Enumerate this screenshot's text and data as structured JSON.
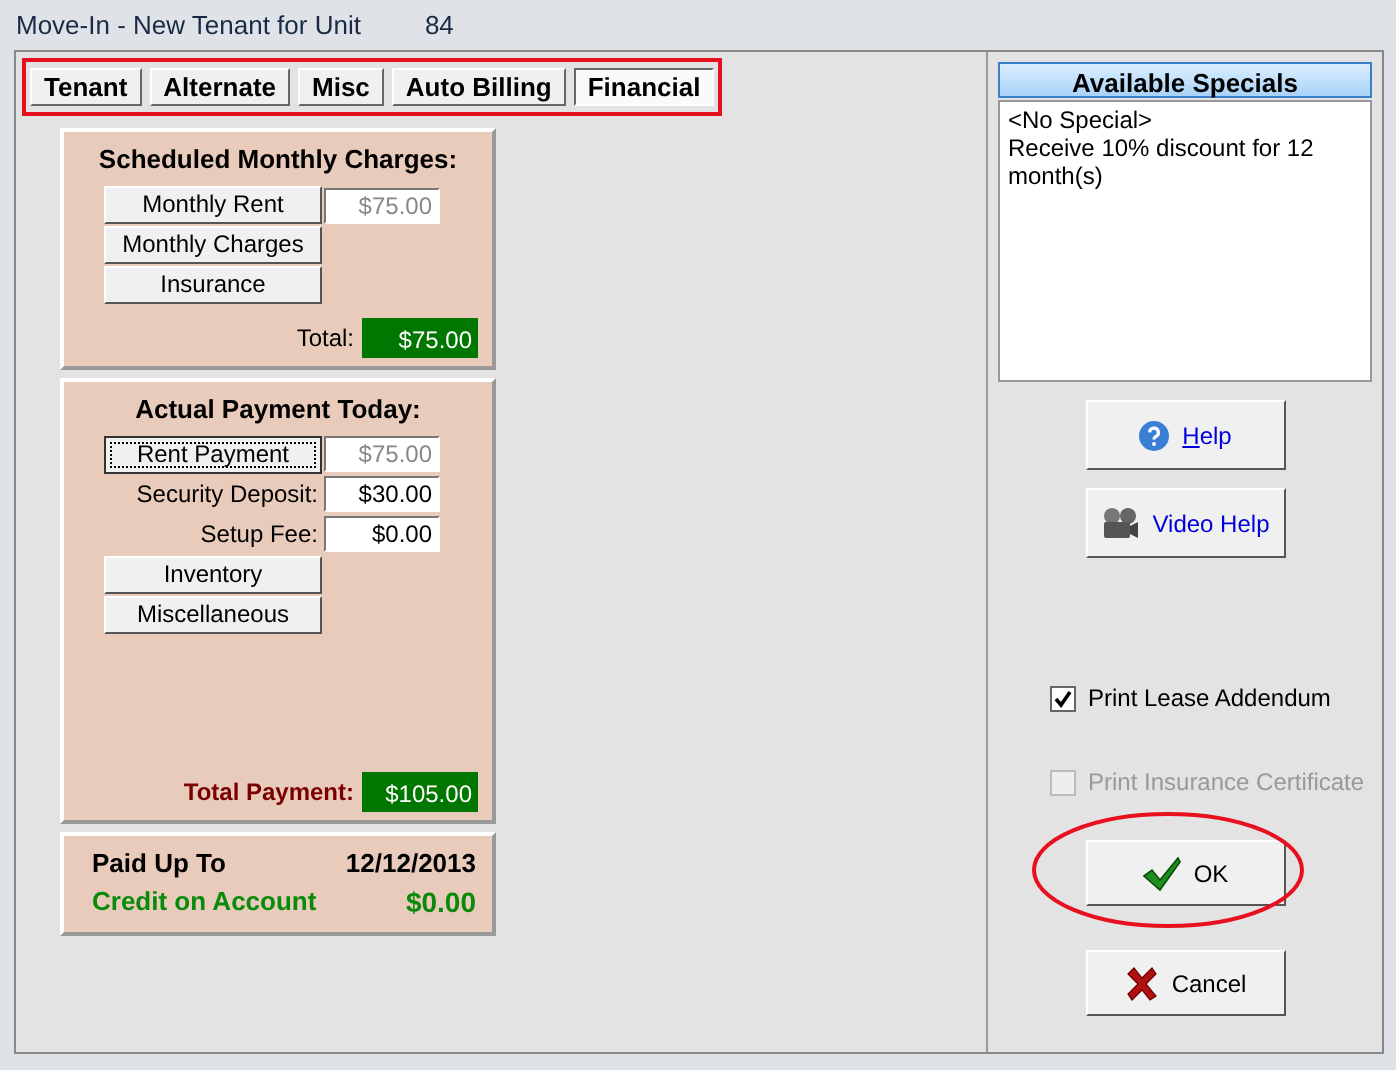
{
  "window": {
    "title": "Move-In - New Tenant for Unit",
    "unit": "84"
  },
  "tabs": {
    "highlighted": true,
    "items": [
      {
        "label": "Tenant",
        "selected": false
      },
      {
        "label": "Alternate",
        "selected": false
      },
      {
        "label": "Misc",
        "selected": false
      },
      {
        "label": "Auto Billing",
        "selected": false
      },
      {
        "label": "Financial",
        "selected": true
      }
    ]
  },
  "scheduled_charges": {
    "title": "Scheduled Monthly Charges:",
    "rows": [
      {
        "kind": "button",
        "label": "Monthly Rent",
        "focused": false,
        "value": "$75.00",
        "readonly": true
      },
      {
        "kind": "button",
        "label": "Monthly Charges",
        "focused": false
      },
      {
        "kind": "button",
        "label": "Insurance",
        "focused": false
      }
    ],
    "total_label": "Total:",
    "total": "$75.00"
  },
  "payment_today": {
    "title": "Actual Payment Today:",
    "rows": [
      {
        "kind": "button",
        "label": "Rent Payment",
        "focused": true,
        "value": "$75.00",
        "readonly": true
      },
      {
        "kind": "label",
        "label": "Security Deposit:",
        "value": "$30.00",
        "readonly": false
      },
      {
        "kind": "label",
        "label": "Setup Fee:",
        "value": "$0.00",
        "readonly": false
      },
      {
        "kind": "button",
        "label": "Inventory",
        "focused": false
      },
      {
        "kind": "button",
        "label": "Miscellaneous",
        "focused": false
      }
    ],
    "total_label": "Total Payment:",
    "total": "$105.00"
  },
  "summary": {
    "paid_up_to_label": "Paid Up To",
    "paid_up_to": "12/12/2013",
    "credit_label": "Credit on Account",
    "credit": "$0.00"
  },
  "specials": {
    "header": "Available Specials",
    "items": [
      "<No Special>",
      "Receive 10% discount for 12 month(s)"
    ]
  },
  "help_buttons": [
    {
      "kind": "help",
      "label": "Help",
      "underline_first": true
    },
    {
      "kind": "video",
      "label": "Video Help",
      "underline_first": false
    }
  ],
  "checkboxes": [
    {
      "label": "Print Lease Addendum",
      "checked": true,
      "disabled": false
    },
    {
      "label": "Print Insurance Certificate",
      "checked": false,
      "disabled": true
    }
  ],
  "dialog_buttons": [
    {
      "kind": "ok",
      "label": "OK",
      "highlighted": true
    },
    {
      "kind": "cancel",
      "label": "Cancel",
      "highlighted": false
    }
  ]
}
